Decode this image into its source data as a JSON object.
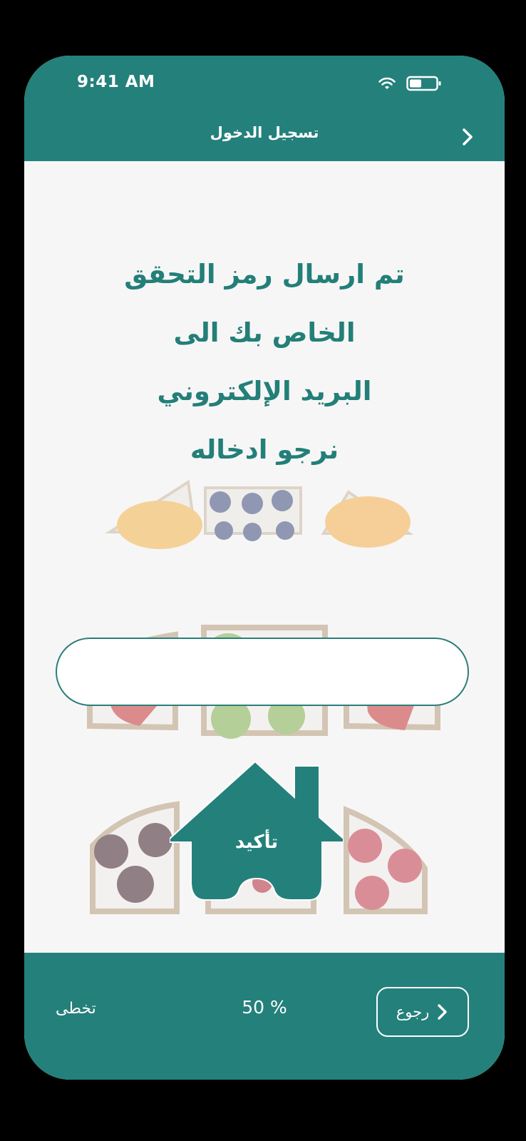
{
  "status_bar": {
    "time": "9:41 AM",
    "icons": [
      "wifi-icon",
      "battery-icon"
    ]
  },
  "header": {
    "title": "تسجيل الدخول",
    "back_icon": "chevron-right-icon"
  },
  "message": {
    "lines": [
      "تم ارسال رمز التحقق",
      "الخاص بك الى",
      "البريد الإلكتروني",
      "نرجو ادخاله"
    ]
  },
  "code_input": {
    "value": "",
    "placeholder": ""
  },
  "confirm_button": {
    "label": "تأكيد"
  },
  "footer": {
    "skip_label": "تخطى",
    "progress_text": "50 %",
    "back_label": "رجوع"
  },
  "colors": {
    "primary": "#24807b",
    "background": "#f7f6f7",
    "text_on_primary": "#ffffff"
  }
}
